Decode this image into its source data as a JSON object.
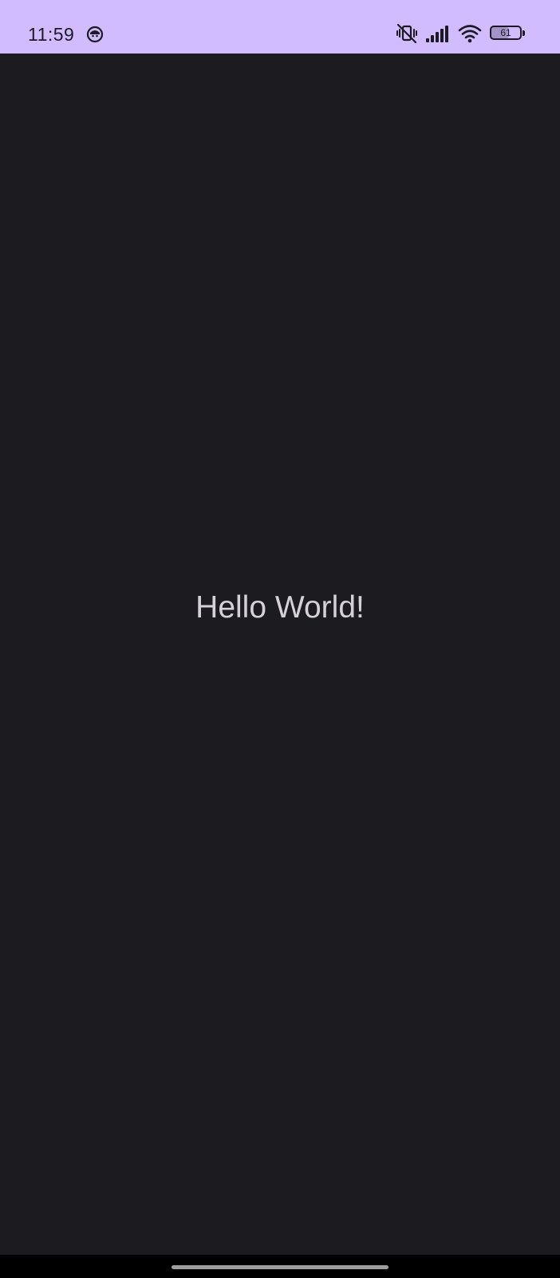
{
  "status_bar": {
    "time": "11:59",
    "app_icon": "app-notification-icon",
    "icons": [
      "vibrate-off-icon",
      "cellular-signal-icon",
      "wifi-icon",
      "battery-icon"
    ],
    "battery_level": "61",
    "background_color": "#d0bcff"
  },
  "main": {
    "text": "Hello World!",
    "background_color": "#1c1b1f",
    "text_color": "#d4d1d8"
  },
  "navigation_bar": {
    "handle": "gesture-handle"
  }
}
